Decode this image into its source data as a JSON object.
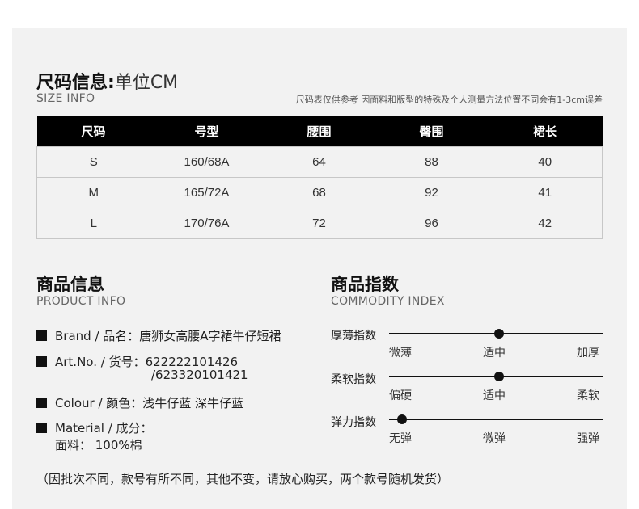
{
  "size_info": {
    "title": "尺码信息:",
    "unit": "单位CM",
    "subtitle": "SIZE INFO",
    "note": "尺码表仅供参考 因面料和版型的特殊及个人测量方法位置不同会有1-3cm误差",
    "headers": [
      "尺码",
      "号型",
      "腰围",
      "臀围",
      "裙长"
    ],
    "rows": [
      [
        "S",
        "160/68A",
        "64",
        "88",
        "40"
      ],
      [
        "M",
        "165/72A",
        "68",
        "92",
        "41"
      ],
      [
        "L",
        "170/76A",
        "72",
        "96",
        "42"
      ]
    ]
  },
  "product_info": {
    "title": "商品信息",
    "subtitle": "PRODUCT INFO",
    "brand": "Brand / 品名：唐狮女高腰A字裙牛仔短裙",
    "art_no_line1": "Art.No. / 货号：622222101426",
    "art_no_line2": "/623320101421",
    "colour": "Colour / 颜色：浅牛仔蓝 深牛仔蓝",
    "material_line1": "Material / 成分：",
    "material_line2": "面料： 100%棉"
  },
  "commodity_index": {
    "title": "商品指数",
    "subtitle": "COMMODITY INDEX",
    "items": [
      {
        "label": "厚薄指数",
        "levels": [
          "微薄",
          "适中",
          "加厚"
        ],
        "value_fraction": 0.5
      },
      {
        "label": "柔软指数",
        "levels": [
          "偏硬",
          "适中",
          "柔软"
        ],
        "value_fraction": 0.5
      },
      {
        "label": "弹力指数",
        "levels": [
          "无弹",
          "微弹",
          "强弹"
        ],
        "value_fraction": 0.0
      }
    ]
  },
  "footer": "（因批次不同，款号有所不同，其他不变，请放心购买，两个款号随机发货）"
}
